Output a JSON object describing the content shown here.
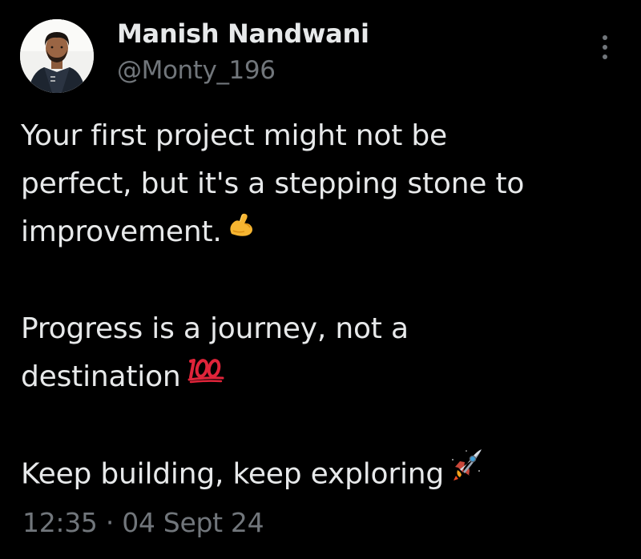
{
  "tweet": {
    "author_name": "Manish Nandwani",
    "handle": "@Monty_196",
    "lines": {
      "l1": "Your first project might not be",
      "l2": "perfect, but it's a stepping stone to",
      "l3": "improvement.",
      "l4": "Progress is a journey, not a",
      "l5": "destination",
      "l6": "Keep building, keep exploring"
    },
    "emojis": {
      "e1": "flexed-biceps",
      "e2": "hundred-points",
      "e3": "rocket"
    },
    "time": "12:35",
    "separator": "·",
    "date": "04 Sept 24"
  },
  "colors": {
    "background": "#000000",
    "text_primary": "#e7e9ea",
    "text_secondary": "#71767b"
  }
}
